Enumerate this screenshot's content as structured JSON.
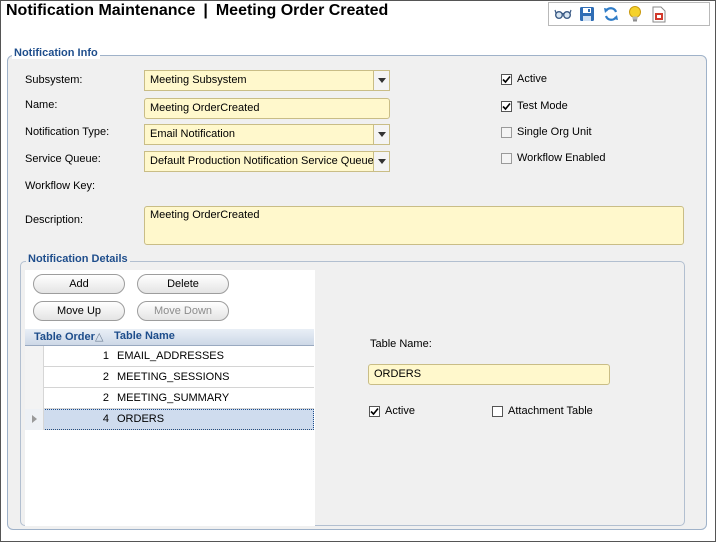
{
  "header": {
    "title": "Notification Maintenance",
    "separator": "|",
    "subtitle": "Meeting Order Created",
    "toolbar": [
      "glasses-icon",
      "save-icon",
      "refresh-icon",
      "lightbulb-icon",
      "report-icon"
    ]
  },
  "info": {
    "legend": "Notification Info",
    "subsystem": {
      "label": "Subsystem:",
      "value": "Meeting Subsystem"
    },
    "name": {
      "label": "Name:",
      "value": "Meeting OrderCreated"
    },
    "notification_type": {
      "label": "Notification Type:",
      "value": "Email Notification"
    },
    "service_queue": {
      "label": "Service Queue:",
      "value": "Default Production Notification Service Queue"
    },
    "workflow_key": {
      "label": "Workflow Key:"
    },
    "description": {
      "label": "Description:",
      "value": "Meeting OrderCreated"
    },
    "checkboxes": [
      {
        "label": "Active",
        "checked": true
      },
      {
        "label": "Test Mode",
        "checked": true
      },
      {
        "label": "Single Org Unit",
        "checked": false
      },
      {
        "label": "Workflow Enabled",
        "checked": false
      }
    ]
  },
  "details": {
    "legend": "Notification Details",
    "buttons": {
      "add": "Add",
      "delete": "Delete",
      "move_up": "Move Up",
      "move_down": "Move Down"
    },
    "grid": {
      "columns": [
        "Table Order",
        "Table Name"
      ],
      "sort_indicator": "△",
      "rows": [
        {
          "order": "1",
          "name": "EMAIL_ADDRESSES"
        },
        {
          "order": "2",
          "name": "MEETING_SESSIONS"
        },
        {
          "order": "2",
          "name": "MEETING_SUMMARY"
        },
        {
          "order": "4",
          "name": "ORDERS"
        }
      ]
    },
    "table_name": {
      "label": "Table Name:",
      "value": "ORDERS"
    },
    "active": {
      "label": "Active",
      "checked": true
    },
    "attachment_table": {
      "label": "Attachment Table",
      "checked": false
    }
  },
  "colors": {
    "accent": "#1f4e8c",
    "field_bg": "#fff8cc",
    "panel_bg": "#f0f0f0"
  }
}
